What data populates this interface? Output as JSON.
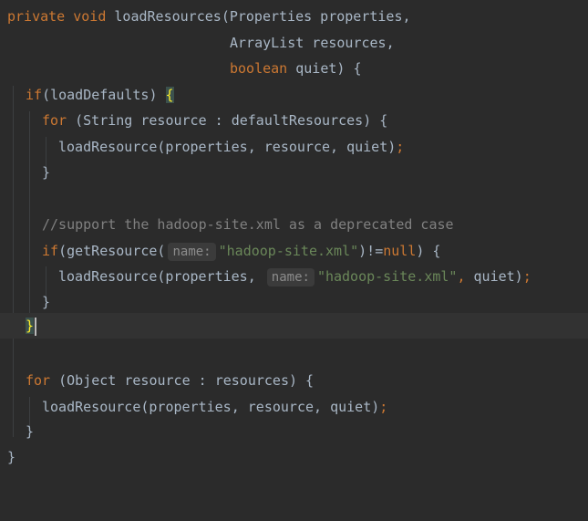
{
  "editor": {
    "lines": {
      "l1": {
        "kw1": "private",
        "kw2": "void",
        "fname": "loadResources",
        "rest": "(Properties properties,"
      },
      "l2": {
        "text": "ArrayList resources,"
      },
      "l3": {
        "kw": "boolean",
        "rest": " quiet) {"
      },
      "l4": {
        "kw": "if",
        "rest": "(loadDefaults) ",
        "brace": "{"
      },
      "l5": {
        "kw": "for",
        "rest": " (String resource : defaultResources) {"
      },
      "l6": {
        "call": "loadResource(properties, resource, quiet)",
        "semi": ";"
      },
      "l7": {
        "text": "}"
      },
      "l9": {
        "comment": "//support the hadoop-site.xml as a deprecated case"
      },
      "l10": {
        "kw": "if",
        "p1": "(getResource(",
        "hint": "name:",
        "str": "\"hadoop-site.xml\"",
        "p2": ")!=",
        "kwnull": "null",
        "p3": ") {"
      },
      "l11": {
        "p1": "loadResource(properties, ",
        "hint": "name:",
        "str": "\"hadoop-site.xml\"",
        "comma": ",",
        "p2": " quiet)",
        "semi": ";"
      },
      "l12": {
        "text": "}"
      },
      "l13": {
        "brace": "}"
      },
      "l15": {
        "kw": "for",
        "rest": " (Object resource : resources) {"
      },
      "l16": {
        "call": "loadResource(properties, resource, quiet)",
        "semi": ";"
      },
      "l17": {
        "text": "}"
      },
      "l18": {
        "text": "}"
      }
    }
  }
}
